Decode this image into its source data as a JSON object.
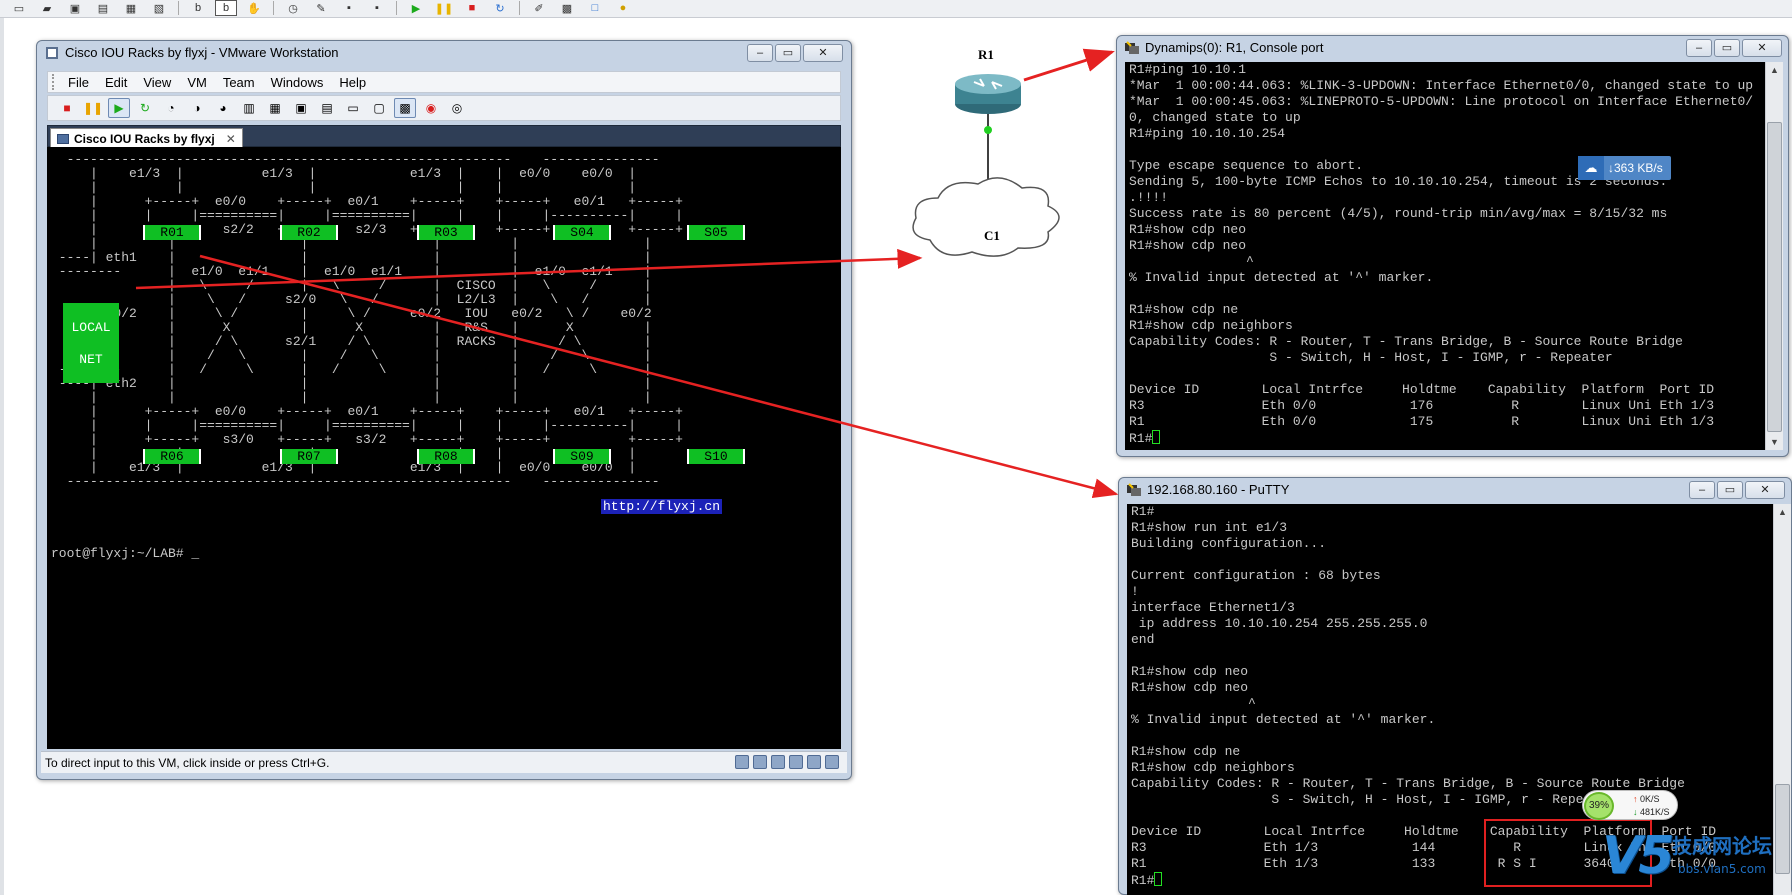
{
  "vmware": {
    "title": "Cisco IOU Racks by flyxj - VMware Workstation",
    "menu": [
      "File",
      "Edit",
      "View",
      "VM",
      "Team",
      "Windows",
      "Help"
    ],
    "tab_label": "Cisco IOU Racks by flyxj",
    "status_text": "To direct input to this VM, click inside or press Ctrl+G.",
    "screen": {
      "nodes": [
        "R01",
        "R02",
        "R03",
        "S04",
        "S05",
        "R06",
        "R07",
        "R08",
        "S09",
        "S10"
      ],
      "local_net": [
        "LOCAL",
        "NET"
      ],
      "link": "http://flyxj.cn",
      "prompt": "root@flyxj:~/LAB# _"
    }
  },
  "topology": {
    "router_label": "R1",
    "cloud_label": "C1"
  },
  "dynamips": {
    "title": "Dynamips(0): R1, Console port",
    "lines": [
      "R1#ping 10.10.1",
      "*Mar  1 00:00:44.063: %LINK-3-UPDOWN: Interface Ethernet0/0, changed state to up",
      "*Mar  1 00:00:45.063: %LINEPROTO-5-UPDOWN: Line protocol on Interface Ethernet0/",
      "0, changed state to up",
      "R1#ping 10.10.10.254",
      "",
      "Type escape sequence to abort.",
      "Sending 5, 100-byte ICMP Echos to 10.10.10.254, timeout is 2 seconds:",
      ".!!!!",
      "Success rate is 80 percent (4/5), round-trip min/avg/max = 8/15/32 ms",
      "R1#show cdp neo",
      "R1#show cdp neo",
      "               ^",
      "% Invalid input detected at '^' marker.",
      "",
      "R1#show cdp ne",
      "R1#show cdp neighbors",
      "Capability Codes: R - Router, T - Trans Bridge, B - Source Route Bridge",
      "                  S - Switch, H - Host, I - IGMP, r - Repeater",
      "",
      "Device ID        Local Intrfce     Holdtme    Capability  Platform  Port ID",
      "R3               Eth 0/0            176          R        Linux Uni Eth 1/3",
      "R1               Eth 0/0            175          R        Linux Uni Eth 1/3"
    ],
    "prompt": "R1#"
  },
  "putty": {
    "title": "192.168.80.160 - PuTTY",
    "lines": [
      "R1#",
      "R1#show run int e1/3",
      "Building configuration...",
      "",
      "Current configuration : 68 bytes",
      "!",
      "interface Ethernet1/3",
      " ip address 10.10.10.254 255.255.255.0",
      "end",
      "",
      "R1#show cdp neo",
      "R1#show cdp neo",
      "               ^",
      "% Invalid input detected at '^' marker.",
      "",
      "R1#show cdp ne",
      "R1#show cdp neighbors",
      "Capability Codes: R - Router, T - Trans Bridge, B - Source Route Bridge",
      "                  S - Switch, H - Host, I - IGMP, r - Repeater",
      "",
      "Device ID        Local Intrfce     Holdtme    Capability  Platform  Port ID",
      "R3               Eth 1/3            144          R        Linux Uni Eth 0/0",
      "R1               Eth 1/3            133        R S I      3640      Eth 0/0"
    ],
    "prompt": "R1#"
  },
  "overlays": {
    "speed": "363 KB/s",
    "meter_pct": "39%",
    "meter_up": "0K/S",
    "meter_down": "481K/S",
    "watermark_cn": "技成网论坛",
    "watermark_url": "bbs.vlan5.com",
    "watermark_logo": "V5"
  },
  "colors": {
    "arrow": "#e52222",
    "node_green": "#0fbf23",
    "link_green": "#22d022"
  }
}
